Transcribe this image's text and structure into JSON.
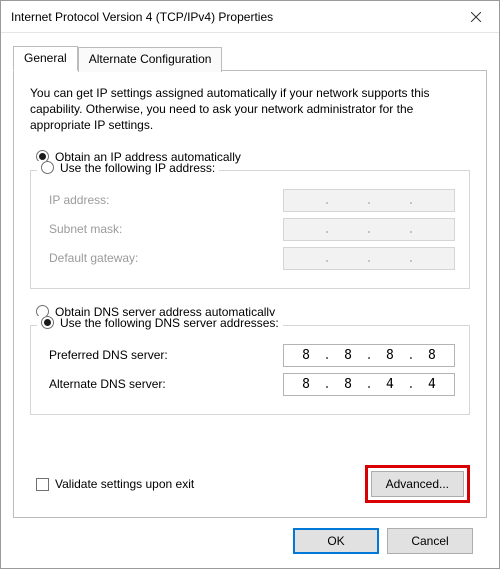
{
  "window": {
    "title": "Internet Protocol Version 4 (TCP/IPv4) Properties"
  },
  "tabs": {
    "general": "General",
    "alternate": "Alternate Configuration"
  },
  "intro": "You can get IP settings assigned automatically if your network supports this capability. Otherwise, you need to ask your network administrator for the appropriate IP settings.",
  "ip": {
    "auto_label": "Obtain an IP address automatically",
    "manual_label": "Use the following IP address:",
    "address_label": "IP address:",
    "subnet_label": "Subnet mask:",
    "gateway_label": "Default gateway:",
    "address_value": "",
    "subnet_value": "",
    "gateway_value": ""
  },
  "dns": {
    "auto_label": "Obtain DNS server address automatically",
    "manual_label": "Use the following DNS server addresses:",
    "preferred_label": "Preferred DNS server:",
    "alternate_label": "Alternate DNS server:",
    "preferred": {
      "o1": "8",
      "o2": "8",
      "o3": "8",
      "o4": "8"
    },
    "alternate": {
      "o1": "8",
      "o2": "8",
      "o3": "4",
      "o4": "4"
    }
  },
  "validate_label": "Validate settings upon exit",
  "buttons": {
    "advanced": "Advanced...",
    "ok": "OK",
    "cancel": "Cancel"
  }
}
